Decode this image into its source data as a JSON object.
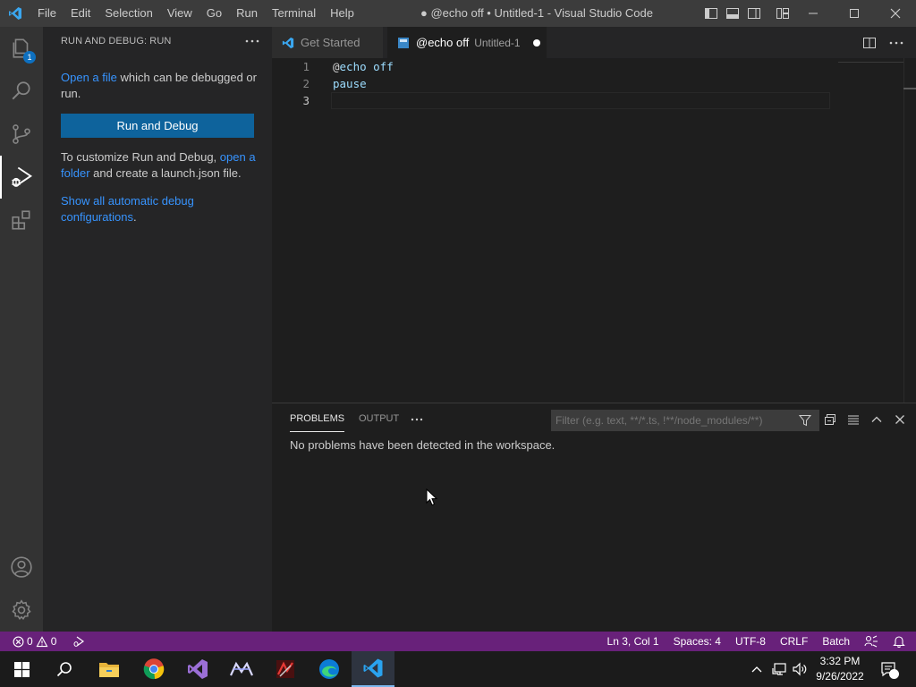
{
  "titlebar": {
    "menu": [
      "File",
      "Edit",
      "Selection",
      "View",
      "Go",
      "Run",
      "Terminal",
      "Help"
    ],
    "title": "● @echo off • Untitled-1 - Visual Studio Code"
  },
  "activitybar": {
    "items": [
      "explorer-icon",
      "search-icon",
      "source-control-icon",
      "run-debug-icon",
      "extensions-icon"
    ],
    "explorer_badge": "1",
    "bottom": [
      "accounts-icon",
      "settings-gear-icon"
    ]
  },
  "sidebar": {
    "title": "RUN AND DEBUG: RUN",
    "open_file_link": "Open a file",
    "open_file_rest": " which can be debugged or run.",
    "run_button": "Run and Debug",
    "customize_text": "To customize Run and Debug, ",
    "open_folder_link": "open a folder",
    "customize_rest": " and create a launch.json file.",
    "show_all_link": "Show all automatic debug configurations",
    "show_all_rest": "."
  },
  "tabs": [
    {
      "label": "Get Started",
      "active": false
    },
    {
      "label": "@echo off",
      "description": "Untitled-1",
      "active": true,
      "dirty": true
    }
  ],
  "editor": {
    "lines": [
      {
        "number": "1",
        "at": "@",
        "text": "echo off"
      },
      {
        "number": "2",
        "at": "",
        "text": "pause"
      },
      {
        "number": "3",
        "at": "",
        "text": ""
      }
    ]
  },
  "panel": {
    "tabs": [
      "PROBLEMS",
      "OUTPUT"
    ],
    "filter_placeholder": "Filter (e.g. text, **/*.ts, !**/node_modules/**)",
    "message": "No problems have been detected in the workspace."
  },
  "statusbar": {
    "errors": "0",
    "warnings": "0",
    "position": "Ln 3, Col 1",
    "spaces": "Spaces: 4",
    "encoding": "UTF-8",
    "eol": "CRLF",
    "language": "Batch"
  },
  "taskbar": {
    "apps": [
      "start-icon",
      "search-icon",
      "file-explorer-icon",
      "chrome-icon",
      "visual-studio-icon",
      "app-icon",
      "game-app-icon",
      "edge-icon",
      "vscode-icon"
    ],
    "time": "3:32 PM",
    "date": "9/26/2022"
  },
  "colors": {
    "statusbar": "#68217a",
    "accent": "#0e639c",
    "link": "#3794ff"
  }
}
